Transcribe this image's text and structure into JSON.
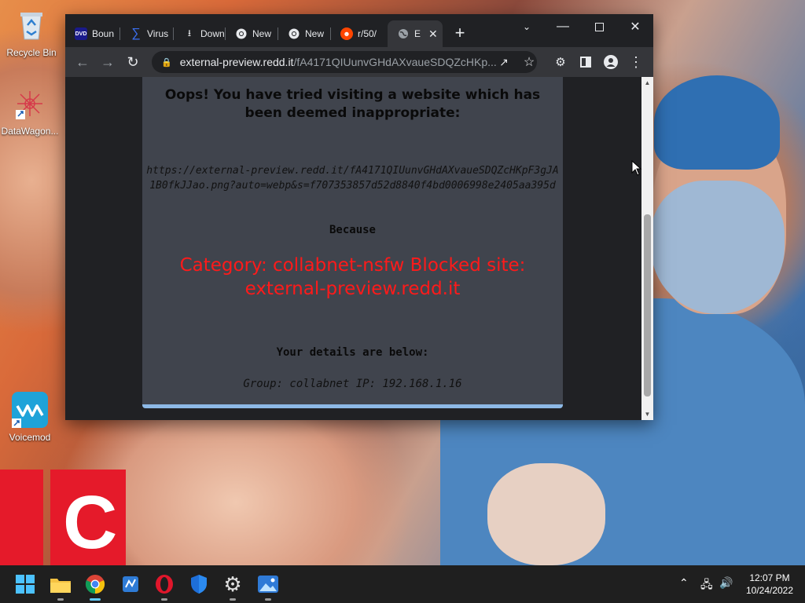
{
  "desktop": {
    "icons": [
      {
        "label": "Recycle Bin"
      },
      {
        "label": "DataWagon..."
      },
      {
        "label": "Voicemod"
      }
    ]
  },
  "browser": {
    "tabs": [
      {
        "label": "Boun",
        "icon": "dvd-icon"
      },
      {
        "label": "Virus",
        "icon": "virustotal-icon"
      },
      {
        "label": "Down",
        "icon": "download-icon"
      },
      {
        "label": "New",
        "icon": "chrome-icon"
      },
      {
        "label": "New",
        "icon": "chrome-icon"
      },
      {
        "label": "r/50/",
        "icon": "reddit-icon"
      },
      {
        "label": "E",
        "icon": "globe-icon"
      }
    ],
    "address": {
      "host": "external-preview.redd.it",
      "path": "/fA4171QIUunvGHdAXvaueSDQZcHKp..."
    }
  },
  "page": {
    "heading": "Oops! You have tried visiting a website which has been deemed inappropriate:",
    "blocked_url": "https://external-preview.redd.it/fA4171QIUunvGHdAXvaueSDQZcHKpF3gJA1B0fkJJao.png?auto=webp&s=f707353857d52d8840f4bd0006998e2405aa395d",
    "because_label": "Because",
    "reason": "Category: collabnet-nsfw  Blocked site: external-preview.redd.it",
    "details_label": "Your details are below:",
    "group_ip": "Group: collabnet   IP: 192.168.1.16"
  },
  "taskbar": {
    "apps": [
      "start-icon",
      "file-explorer-icon",
      "chrome-icon",
      "app-icon",
      "opera-icon",
      "defender-icon",
      "settings-icon",
      "photos-icon"
    ],
    "time": "12:07 PM",
    "date": "10/24/2022"
  },
  "colors": {
    "reason_text": "#ff1a1a",
    "panel_bg": "#40444d",
    "accent": "#60cdff"
  }
}
